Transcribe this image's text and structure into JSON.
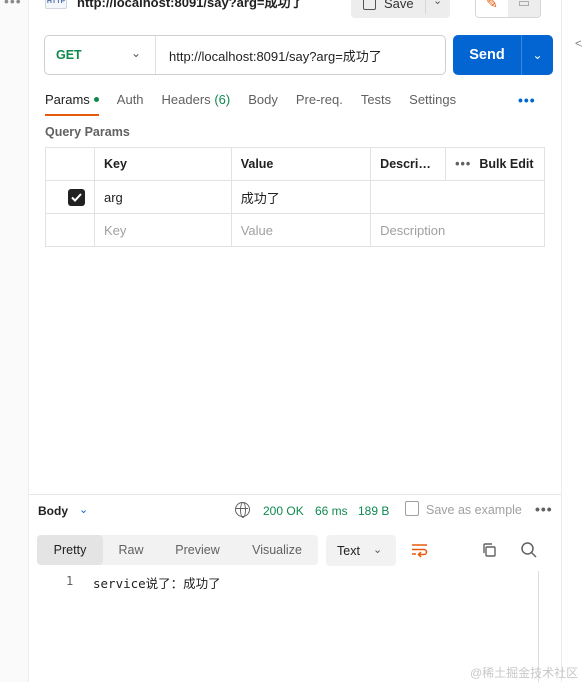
{
  "request": {
    "title": "http://localhost:8091/say?arg=成功了",
    "http_badge": "HTTP",
    "save_label": "Save",
    "method": "GET",
    "url": "http://localhost:8091/say?arg=成功了",
    "send_label": "Send"
  },
  "tabs": [
    {
      "label": "Params",
      "active": true
    },
    {
      "label": "Auth"
    },
    {
      "label": "Headers",
      "count": "(6)"
    },
    {
      "label": "Body"
    },
    {
      "label": "Pre-req."
    },
    {
      "label": "Tests"
    },
    {
      "label": "Settings"
    }
  ],
  "more_dots": "•••",
  "query_params": {
    "title": "Query Params",
    "headers": {
      "key": "Key",
      "value": "Value",
      "description": "Description",
      "bulk_edit": "Bulk Edit"
    },
    "rows": [
      {
        "checked": true,
        "key": "arg",
        "value": "成功了",
        "description": ""
      }
    ],
    "placeholders": {
      "key": "Key",
      "value": "Value",
      "description": "Description"
    }
  },
  "response": {
    "body_label": "Body",
    "status": "200 OK",
    "time": "66 ms",
    "size": "189 B",
    "save_as_example": "Save as example",
    "view_tabs": [
      {
        "label": "Pretty",
        "active": true
      },
      {
        "label": "Raw"
      },
      {
        "label": "Preview"
      },
      {
        "label": "Visualize"
      }
    ],
    "format": "Text",
    "lines": [
      {
        "num": "1",
        "text": "service说了：成功了"
      }
    ]
  },
  "watermark": "@稀土掘金技术社区",
  "colors": {
    "accent": "#0265d2",
    "success": "#0f8a4e",
    "tab_indicator": "#e8590c"
  }
}
